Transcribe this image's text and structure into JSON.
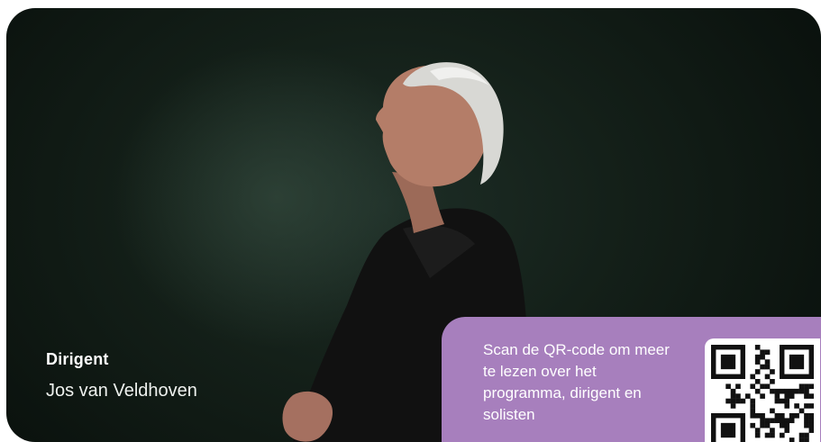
{
  "credit": {
    "role": "Dirigent",
    "name": "Jos van Veldhoven"
  },
  "qr_panel": {
    "text": "Scan de QR-code om meer te lezen over het programma, dirigent en solisten"
  },
  "colors": {
    "background": "#14201a",
    "panel": "#a77fbd"
  },
  "icons": {
    "qr": "qr-code-icon"
  }
}
